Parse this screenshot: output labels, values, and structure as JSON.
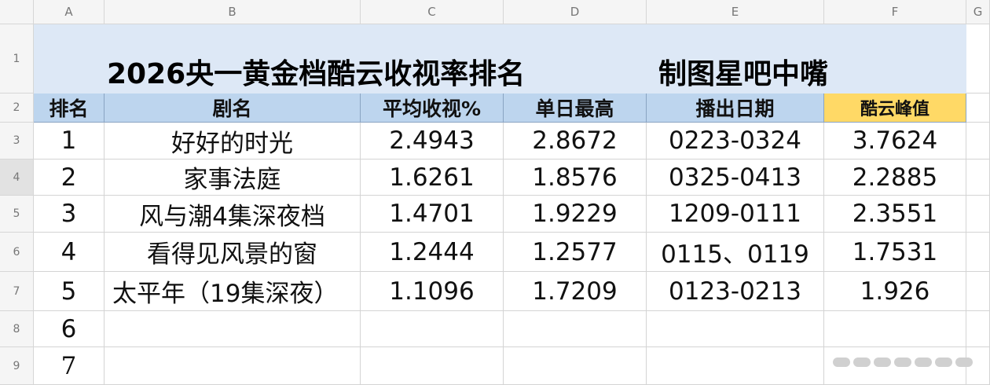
{
  "columns": [
    "A",
    "B",
    "C",
    "D",
    "E",
    "F",
    "G"
  ],
  "rows": [
    "1",
    "2",
    "3",
    "4",
    "5",
    "6",
    "7",
    "8",
    "9"
  ],
  "title": {
    "main": "2026央一黄金档酷云收视率排名",
    "credit": "制图星吧中嘴"
  },
  "header": {
    "rank": "排名",
    "drama": "剧名",
    "avg": "平均收视%",
    "peak_day": "单日最高",
    "dates": "播出日期",
    "kuyun_peak": "酷云峰值"
  },
  "table": [
    {
      "rank": "1",
      "drama": "好好的时光",
      "avg": "2.4943",
      "peak_day": "2.8672",
      "dates": "0223-0324",
      "kuyun_peak": "3.7624"
    },
    {
      "rank": "2",
      "drama": "家事法庭",
      "avg": "1.6261",
      "peak_day": "1.8576",
      "dates": "0325-0413",
      "kuyun_peak": "2.2885"
    },
    {
      "rank": "3",
      "drama": "风与潮4集深夜档",
      "avg": "1.4701",
      "peak_day": "1.9229",
      "dates": "1209-0111",
      "kuyun_peak": "2.3551"
    },
    {
      "rank": "4",
      "drama": "看得见风景的窗",
      "avg": "1.2444",
      "peak_day": "1.2577",
      "dates": "0115、0119",
      "kuyun_peak": "1.7531"
    },
    {
      "rank": "5",
      "drama": "太平年（19集深夜）",
      "avg": "1.1096",
      "peak_day": "1.7209",
      "dates": "0123-0213",
      "kuyun_peak": "1.926"
    }
  ],
  "extra_ranks": [
    "6",
    "7"
  ],
  "colors": {
    "title_band": "#dde8f6",
    "header_blue": "#bdd5ee",
    "header_gold": "#ffd966"
  }
}
